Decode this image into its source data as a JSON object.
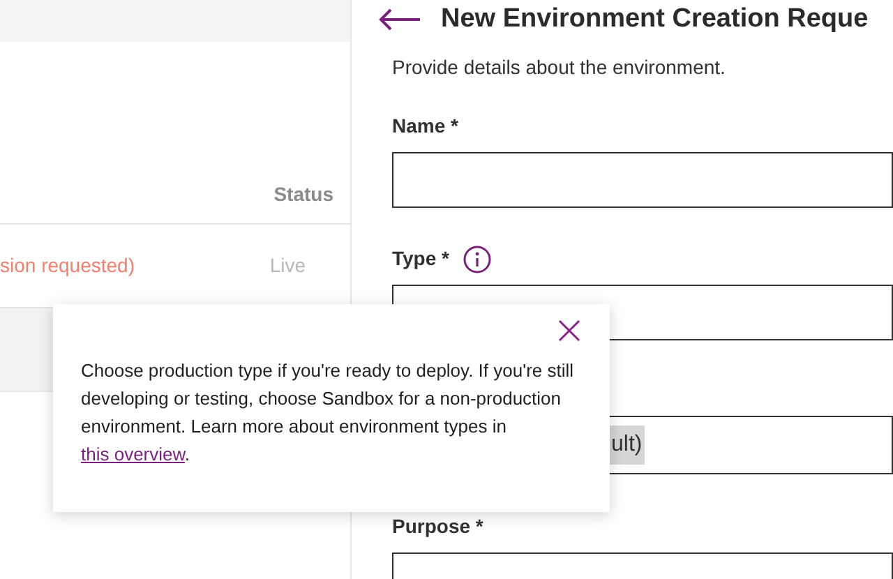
{
  "list": {
    "column_header": "Status",
    "rows": [
      {
        "name": "sion requested)",
        "status": "Live",
        "selected": false
      },
      {
        "selected": true
      }
    ]
  },
  "panel": {
    "title": "New Environment Creation Reque",
    "description": "Provide details about the environment.",
    "fields": [
      {
        "label": "Name *"
      },
      {
        "label": "Type *",
        "info": true
      },
      {
        "value": "ult)",
        "highlighted": true
      },
      {
        "label": "Purpose *"
      }
    ]
  },
  "popover": {
    "text": "Choose production type if you're ready to deploy. If you're still developing or testing, choose Sandbox for a non-production environment. Learn more about environment types in ",
    "link": "this overview",
    "after": "."
  }
}
